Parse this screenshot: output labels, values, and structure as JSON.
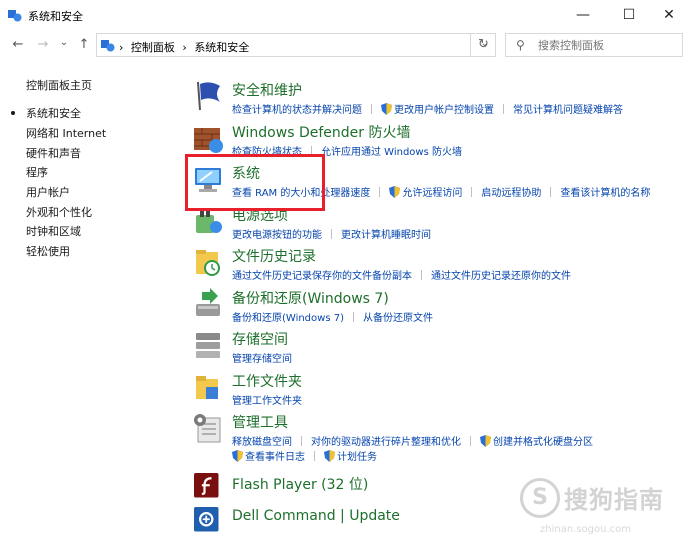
{
  "window": {
    "title": "系统和安全",
    "minimize": "—",
    "maximize": "☐",
    "close": "✕"
  },
  "address": {
    "back": "←",
    "forward": "→",
    "recent": "⌄",
    "up": "↑",
    "breadcrumb_separator": "›",
    "crumbs": [
      "控制面板",
      "系统和安全"
    ],
    "dropdown": "⌄",
    "refresh": "↻"
  },
  "search": {
    "icon": "⚲",
    "placeholder": "搜索控制面板"
  },
  "sidebar": {
    "items": [
      {
        "label": "控制面板主页"
      },
      {
        "label": "系统和安全"
      },
      {
        "label": "网络和 Internet"
      },
      {
        "label": "硬件和声音"
      },
      {
        "label": "程序"
      },
      {
        "label": "用户帐户"
      },
      {
        "label": "外观和个性化"
      },
      {
        "label": "时钟和区域"
      },
      {
        "label": "轻松使用"
      }
    ]
  },
  "categories": [
    {
      "title": "安全和维护",
      "icon": "flag-icon",
      "links": [
        "检查计算机的状态并解决问题",
        "更改用户帐户控制设置",
        "常见计算机问题疑难解答"
      ]
    },
    {
      "title": "Windows Defender 防火墙",
      "icon": "firewall-icon",
      "links": [
        "检查防火墙状态",
        "允许应用通过 Windows 防火墙"
      ]
    },
    {
      "title": "系统",
      "icon": "computer-icon",
      "links": [
        "查看 RAM 的大小和处理器速度",
        "允许远程访问",
        "启动远程协助",
        "查看该计算机的名称"
      ]
    },
    {
      "title": "电源选项",
      "icon": "power-icon",
      "links": [
        "更改电源按钮的功能",
        "更改计算机睡眠时间"
      ]
    },
    {
      "title": "文件历史记录",
      "icon": "file-history-icon",
      "links": [
        "通过文件历史记录保存你的文件备份副本",
        "通过文件历史记录还原你的文件"
      ]
    },
    {
      "title": "备份和还原(Windows 7)",
      "icon": "backup-icon",
      "links": [
        "备份和还原(Windows 7)",
        "从备份还原文件"
      ]
    },
    {
      "title": "存储空间",
      "icon": "storage-icon",
      "links": [
        "管理存储空间"
      ]
    },
    {
      "title": "工作文件夹",
      "icon": "work-folder-icon",
      "links": [
        "管理工作文件夹"
      ]
    },
    {
      "title": "管理工具",
      "icon": "admin-tools-icon",
      "links": [
        "释放磁盘空间",
        "对你的驱动器进行碎片整理和优化",
        "创建并格式化硬盘分区",
        "查看事件日志",
        "计划任务"
      ]
    },
    {
      "title": "Flash Player (32 位)",
      "icon": "flash-icon",
      "links": []
    },
    {
      "title": "Dell Command | Update",
      "icon": "dell-update-icon",
      "links": []
    }
  ],
  "watermark": {
    "logo": "S",
    "text": "搜狗指南",
    "url": "zhinan.sogou.com"
  },
  "colors": {
    "category_title": "#1e6f2c",
    "link": "#0645ad",
    "highlight_border": "#e8202b"
  }
}
